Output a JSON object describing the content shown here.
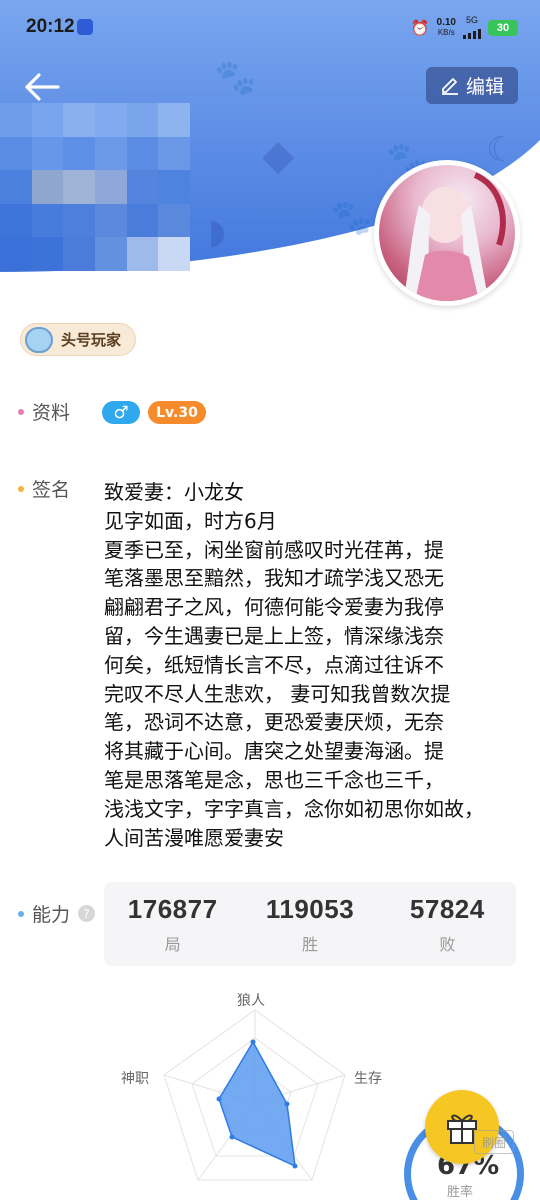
{
  "status_bar": {
    "time": "20:12",
    "net_speed": "0.10",
    "net_unit": "KB/s",
    "net_type": "5G",
    "battery": "30"
  },
  "header": {
    "back_icon": "arrow-left-icon",
    "edit_label": "编辑",
    "edit_icon": "pencil-icon"
  },
  "badge": {
    "label": "头号玩家"
  },
  "profile": {
    "label": "资料",
    "gender_icon": "male-icon",
    "level": "Lv.30"
  },
  "signature": {
    "label": "签名",
    "lines": [
      "致爱妻：小龙女",
      "见字如面，时方6月",
      "夏季已至，闲坐窗前感叹时光荏苒，提",
      "笔落墨思至黯然，我知才疏学浅又恐无",
      "翩翩君子之风，何德何能令爱妻为我停",
      "留，今生遇妻已是上上签，情深缘浅奈",
      "何矣，纸短情长言不尽，点滴过往诉不",
      "完叹不尽人生悲欢，  妻可知我曾数次提",
      "笔，恐词不达意，更恐爱妻厌烦，无奈",
      "将其藏于心间。唐突之处望妻海涵。提",
      "笔是思落笔是念，思也三千念也三千，",
      "浅浅文字，字字真言，念你如初思你如故，",
      "人间苦漫唯愿爱妻安"
    ]
  },
  "ability": {
    "label": "能力",
    "help_icon": "question-icon",
    "stats": [
      {
        "value": "176877",
        "label": "局"
      },
      {
        "value": "119053",
        "label": "胜"
      },
      {
        "value": "57824",
        "label": "败"
      }
    ]
  },
  "radar": {
    "axes": [
      "狼人",
      "生存",
      "",
      "",
      "神职"
    ]
  },
  "winrate": {
    "value": "67%",
    "label": "胜率"
  },
  "gift_icon": "gift-icon",
  "colors": {
    "accent": "#3d74db",
    "male": "#2fa8ee",
    "level": "#f58b2a",
    "gift": "#f6c623"
  }
}
